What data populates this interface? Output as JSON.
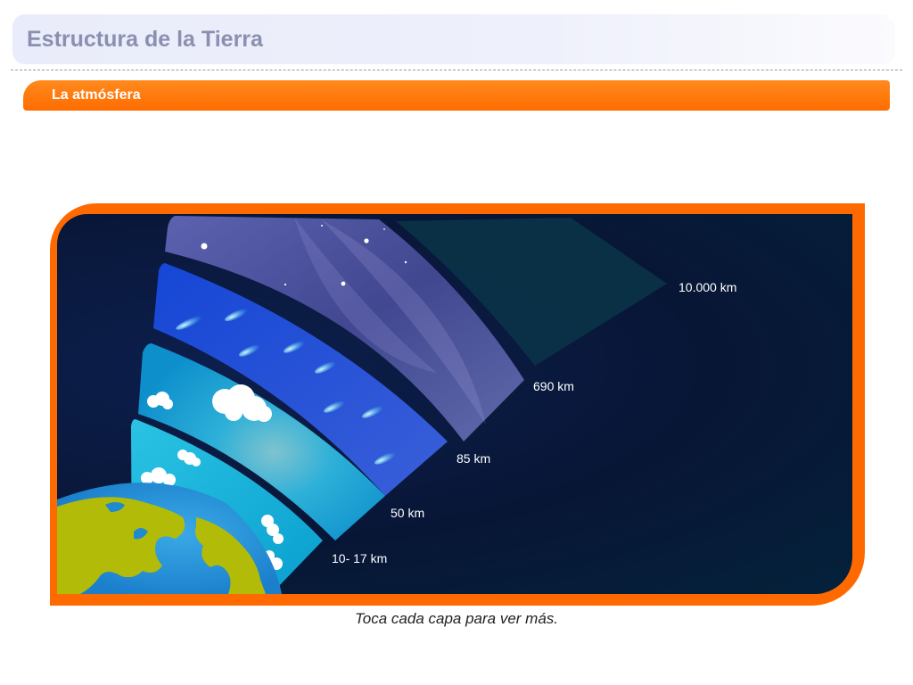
{
  "header": {
    "title": "Estructura de la Tierra"
  },
  "section": {
    "label": "La atmósfera"
  },
  "diagram": {
    "layers": [
      {
        "id": "troposfera",
        "km_label": "10- 17 km",
        "color": "#19b2d6"
      },
      {
        "id": "estratosfera",
        "km_label": "50 km",
        "color": "#1aa6d2"
      },
      {
        "id": "mesosfera",
        "km_label": "85 km",
        "color": "#2457d8"
      },
      {
        "id": "termosfera",
        "km_label": "690 km",
        "color": "#5e67b8"
      },
      {
        "id": "exosfera",
        "km_label": "10.000 km",
        "color": "#0b3348"
      }
    ]
  },
  "caption": "Toca cada capa para ver más.",
  "colors": {
    "accent": "#ff6a00",
    "space": "#081636",
    "title": "#8b8fb0"
  }
}
